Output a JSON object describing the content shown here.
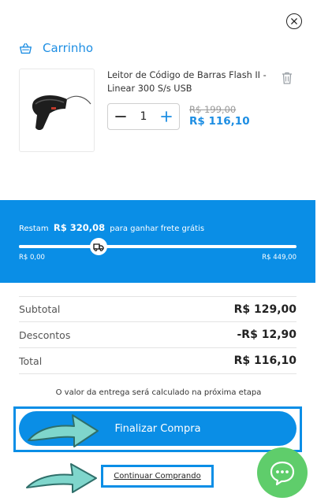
{
  "header": {
    "cart_title": "Carrinho"
  },
  "product": {
    "name": "Leitor de Código de Barras Flash II - Linear 300 S/s USB",
    "quantity": "1",
    "price_old": "R$ 199,00",
    "price_new": "R$ 116,10"
  },
  "shipping": {
    "message_prefix": "Restam",
    "remaining": "R$ 320,08",
    "message_suffix": "para ganhar frete grátis",
    "min_label": "R$ 0,00",
    "max_label": "R$ 449,00",
    "progress_fraction": 0.2871
  },
  "totals": {
    "rows": [
      {
        "label": "Subtotal",
        "value": "R$ 129,00"
      },
      {
        "label": "Descontos",
        "value": "-R$ 12,90"
      },
      {
        "label": "Total",
        "value": "R$ 116,10"
      }
    ]
  },
  "shipping_note": "O valor da entrega será calculado na próxima etapa",
  "actions": {
    "checkout_label": "Finalizar Compra",
    "continue_label": "Continuar Comprando"
  },
  "colors": {
    "accent": "#0a8ee6",
    "link": "#1d8ee3",
    "arrow": "#7fd6cc",
    "chat": "#5fcd6b"
  },
  "icons": [
    "close-icon",
    "basket-icon",
    "trash-icon",
    "minus-icon",
    "plus-icon",
    "truck-icon",
    "chat-icon"
  ]
}
